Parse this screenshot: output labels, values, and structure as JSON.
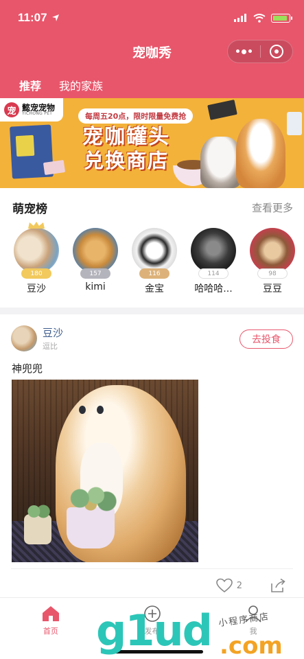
{
  "status_bar": {
    "time": "11:07"
  },
  "header": {
    "title": "宠咖秀",
    "tabs": [
      {
        "label": "推荐",
        "active": true
      },
      {
        "label": "我的家族",
        "active": false
      }
    ]
  },
  "banner": {
    "brand_cn": "懿宠宠物",
    "brand_en": "YICHONG PET",
    "brand_logo_char": "宠",
    "promo": "每周五20点，限时限量免费抢",
    "title_line1": "宠咖罐头",
    "title_line2": "兑换商店"
  },
  "ranking": {
    "title": "萌宠榜",
    "more": "查看更多",
    "items": [
      {
        "name": "豆沙",
        "score": "180",
        "medal": "gold"
      },
      {
        "name": "kimi",
        "score": "157",
        "medal": "silver"
      },
      {
        "name": "金宝",
        "score": "116",
        "medal": "bronze"
      },
      {
        "name": "哈哈哈...",
        "score": "114",
        "medal": "none"
      },
      {
        "name": "豆豆",
        "score": "98",
        "medal": "none"
      }
    ]
  },
  "post": {
    "author": "豆沙",
    "author_sub": "逗比",
    "feed_button": "去投食",
    "caption": "神兜兜",
    "likes": "2"
  },
  "tabbar": {
    "items": [
      {
        "label": "首页",
        "active": true,
        "icon": "home-icon"
      },
      {
        "label": "发布",
        "active": false,
        "icon": "add-circle-icon"
      },
      {
        "label": "我",
        "active": false,
        "icon": "person-icon"
      }
    ]
  },
  "watermark": {
    "big": "g1ud",
    "com": ".com",
    "sub": "小程序商店"
  },
  "colors": {
    "accent": "#e8566b",
    "banner": "#f3b23a",
    "link": "#3b5b8c"
  }
}
